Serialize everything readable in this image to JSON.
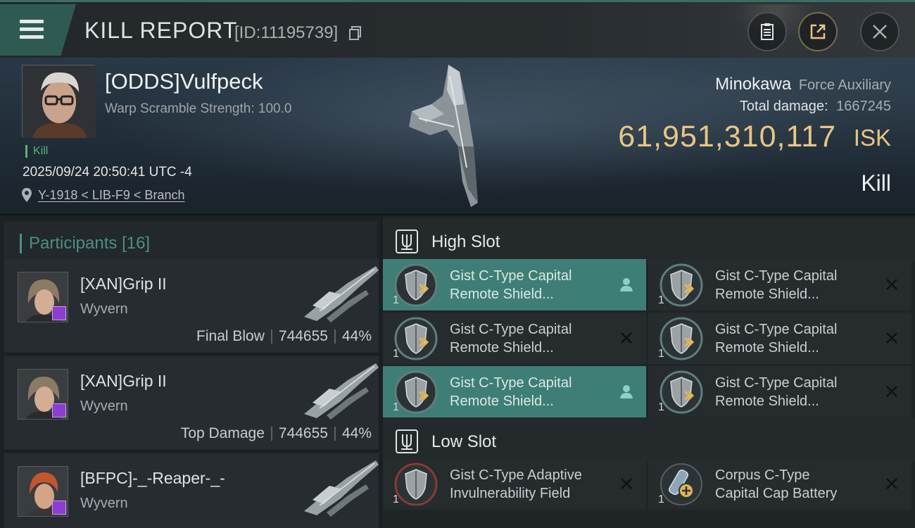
{
  "header": {
    "title": "KILL REPORT",
    "id_text": "[ID:11195739]"
  },
  "victim": {
    "name": "[ODDS]Vulfpeck",
    "detail": "Warp Scramble Strength: 100.0",
    "tag": "Kill",
    "timestamp": "2025/09/24 20:50:41 UTC -4",
    "location": "Y-1918 < LIB-F9 < Branch",
    "ship_name": "Minokawa",
    "ship_class": "Force Auxiliary",
    "total_damage_label": "Total damage:",
    "total_damage_value": "1667245",
    "isk_value": "61,951,310,117",
    "isk_label": "ISK",
    "result": "Kill"
  },
  "participants": {
    "label": "Participants",
    "count": "[16]",
    "items": [
      {
        "name": "[XAN]Grip II",
        "ship": "Wyvern",
        "role": "Final Blow",
        "damage": "744655",
        "percent": "44%"
      },
      {
        "name": "[XAN]Grip II",
        "ship": "Wyvern",
        "role": "Top Damage",
        "damage": "744655",
        "percent": "44%"
      },
      {
        "name": "[BFPC]-_-Reaper-_-",
        "ship": "Wyvern",
        "role": "",
        "damage": "",
        "percent": ""
      }
    ]
  },
  "fitting": {
    "high_slot": {
      "title": "High Slot",
      "modules": [
        {
          "line1": "Gist C-Type Capital",
          "line2": "Remote Shield...",
          "qty": "1",
          "status": "user",
          "active": true
        },
        {
          "line1": "Gist C-Type Capital",
          "line2": "Remote Shield...",
          "qty": "1",
          "status": "destroyed",
          "active": false
        },
        {
          "line1": "Gist C-Type Capital",
          "line2": "Remote Shield...",
          "qty": "1",
          "status": "destroyed",
          "active": false
        },
        {
          "line1": "Gist C-Type Capital",
          "line2": "Remote Shield...",
          "qty": "1",
          "status": "destroyed",
          "active": false
        },
        {
          "line1": "Gist C-Type Capital",
          "line2": "Remote Shield...",
          "qty": "1",
          "status": "user",
          "active": true
        },
        {
          "line1": "Gist C-Type Capital",
          "line2": "Remote Shield...",
          "qty": "1",
          "status": "destroyed",
          "active": false
        }
      ]
    },
    "low_slot": {
      "title": "Low Slot",
      "modules": [
        {
          "line1": "Gist C-Type Adaptive",
          "line2": "Invulnerability Field",
          "qty": "1",
          "status": "destroyed",
          "active": false
        },
        {
          "line1": "Corpus C-Type",
          "line2": "Capital Cap Battery",
          "qty": "1",
          "status": "destroyed",
          "active": false
        }
      ]
    }
  },
  "colors": {
    "accent_teal": "#3e7e76",
    "isk_gold": "#e8c684",
    "kill_green": "#5bb07f",
    "badge_purple": "#8c3fcf"
  },
  "icons": {
    "menu": "hamburger-icon",
    "copy": "copy-icon",
    "report": "clipboard-icon",
    "share": "share-icon",
    "close": "close-icon",
    "location": "location-pin-icon",
    "slot": "slot-fork-icon",
    "module_status_user": "user-icon",
    "module_status_destroyed": "x-icon"
  }
}
